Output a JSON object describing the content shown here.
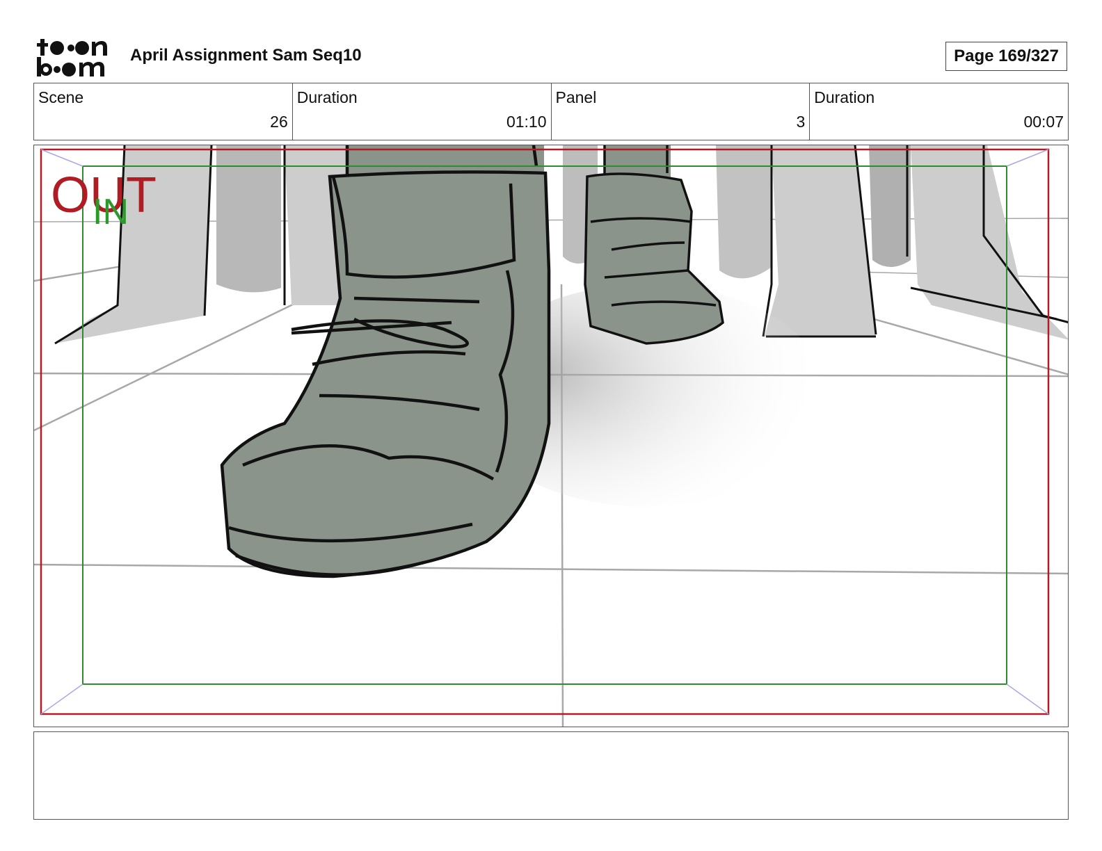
{
  "header": {
    "logo": {
      "line1": "toon",
      "line2": "boom",
      "icon": "toonboom-logo"
    },
    "title": "April Assignment Sam Seq10",
    "page_label": "Page 169/327"
  },
  "info": {
    "scene_label": "Scene",
    "scene_value": "26",
    "scene_duration_label": "Duration",
    "scene_duration_value": "01:10",
    "panel_label": "Panel",
    "panel_value": "3",
    "panel_duration_label": "Duration",
    "panel_duration_value": "00:07"
  },
  "panel": {
    "out_marker": "OUT",
    "in_marker": "IN",
    "colors": {
      "out_frame": "#b01c24",
      "in_frame": "#2e8b2e",
      "boot": "#8a948a",
      "legs": "#cccccc"
    }
  },
  "notes": {
    "text": ""
  }
}
